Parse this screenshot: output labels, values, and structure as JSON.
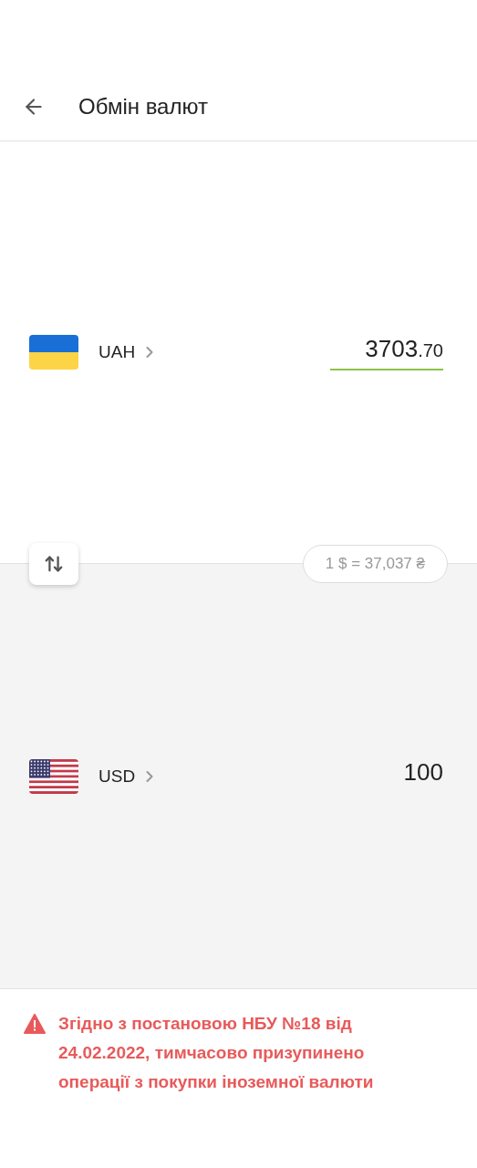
{
  "header": {
    "title": "Обмін валют"
  },
  "accounts": [
    {
      "currency": "UAH",
      "kind": "ukraine",
      "amount": "3703",
      "fraction": ".70",
      "focused": true
    },
    {
      "currency": "USD",
      "kind": "usa",
      "amount": "100",
      "focused": false
    }
  ],
  "rate": "1 $ = 37,037 ₴",
  "notice": "Згідно з постановою НБУ №18 від 24.02.2022, тимчасово призупинено операції з покупки іноземної валюти"
}
